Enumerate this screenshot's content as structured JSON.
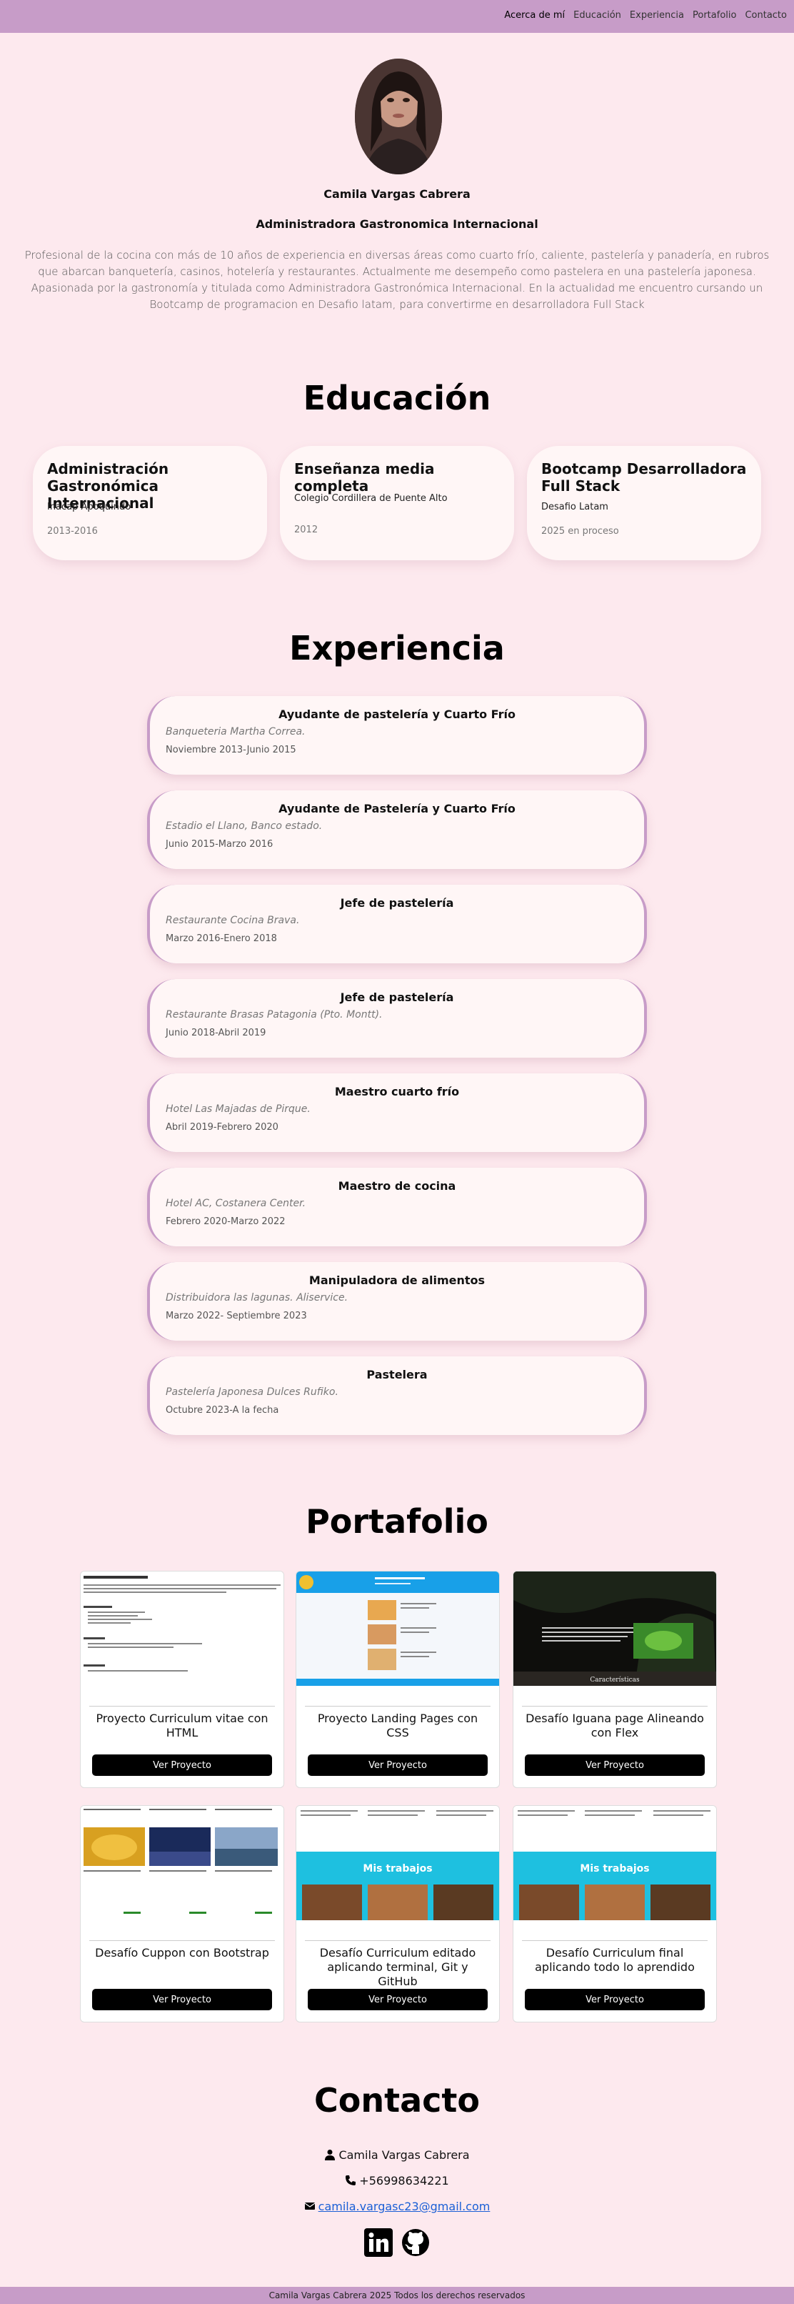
{
  "nav": {
    "items": [
      "Acerca de mí",
      "Educación",
      "Experiencia",
      "Portafolio",
      "Contacto"
    ]
  },
  "about": {
    "name": "Camila Vargas Cabrera",
    "role": "Administradora Gastronomica Internacional",
    "bio": "Profesional de la cocina con más de 10 años de experiencia en diversas áreas como cuarto frío, caliente, pastelería y panadería, en rubros que abarcan banquetería, casinos, hotelería y restaurantes. Actualmente me desempeño como pastelera en una pastelería japonesa. Apasionada por la gastronomía y titulada como Administradora Gastronómica Internacional. En la actualidad me encuentro cursando un Bootcamp de programacion en Desafio latam, para convertirme en desarrolladora Full Stack"
  },
  "education": {
    "title": "Educación",
    "items": [
      {
        "title": "Administración Gastronómica Internacional",
        "institution": "Inacap Apoquindo",
        "years": "2013-2016"
      },
      {
        "title": "Enseñanza media completa",
        "institution": "Colegio Cordillera de Puente Alto",
        "years": "2012"
      },
      {
        "title": "Bootcamp Desarrolladora Full Stack",
        "institution": "Desafio Latam",
        "years": "2025 en proceso"
      }
    ]
  },
  "experience": {
    "title": "Experiencia",
    "items": [
      {
        "title": "Ayudante de pastelería y Cuarto Frío",
        "place": "Banqueteria Martha Correa.",
        "dates": "Noviembre 2013-Junio 2015"
      },
      {
        "title": "Ayudante de Pastelería y Cuarto Frío",
        "place": "Estadio el Llano, Banco estado.",
        "dates": "Junio 2015-Marzo 2016"
      },
      {
        "title": "Jefe de pastelería",
        "place": "Restaurante Cocina Brava.",
        "dates": "Marzo 2016-Enero 2018"
      },
      {
        "title": "Jefe de pastelería",
        "place": "Restaurante Brasas Patagonia (Pto. Montt).",
        "dates": "Junio 2018-Abril 2019"
      },
      {
        "title": "Maestro cuarto frío",
        "place": "Hotel Las Majadas de Pirque.",
        "dates": "Abril 2019-Febrero 2020"
      },
      {
        "title": "Maestro de cocina",
        "place": "Hotel AC, Costanera Center.",
        "dates": "Febrero 2020-Marzo 2022"
      },
      {
        "title": "Manipuladora de alimentos",
        "place": "Distribuidora las lagunas. Aliservice.",
        "dates": "Marzo 2022- Septiembre 2023"
      },
      {
        "title": "Pastelera",
        "place": "Pastelería Japonesa Dulces Rufiko.",
        "dates": "Octubre 2023-A la fecha"
      }
    ]
  },
  "portfolio": {
    "title": "Portafolio",
    "button_label": "Ver Proyecto",
    "items": [
      {
        "title": "Proyecto Curriculum vitae con HTML"
      },
      {
        "title": "Proyecto Landing Pages con CSS"
      },
      {
        "title": "Desafío Iguana page Alineando con Flex"
      },
      {
        "title": "Desafío Cuppon con Bootstrap"
      },
      {
        "title": "Desafío Curriculum editado aplicando terminal, Git y GitHub"
      },
      {
        "title": "Desafío Curriculum final aplicando todo lo aprendido"
      }
    ],
    "thumb_text": {
      "mis_trabajos": "Mis trabajos",
      "caracteristicas": "Características"
    }
  },
  "contact": {
    "title": "Contacto",
    "name": "Camila Vargas Cabrera",
    "phone": "+56998634221",
    "email": "camila.vargasc23@gmail.com"
  },
  "footer": {
    "text": "Camila Vargas Cabrera 2025 Todos los derechos reservados"
  },
  "colors": {
    "background": "#fde9ee",
    "nav": "#c79cc8",
    "card": "#fff6f6",
    "button": "#000000",
    "link": "#1a5fd6"
  }
}
